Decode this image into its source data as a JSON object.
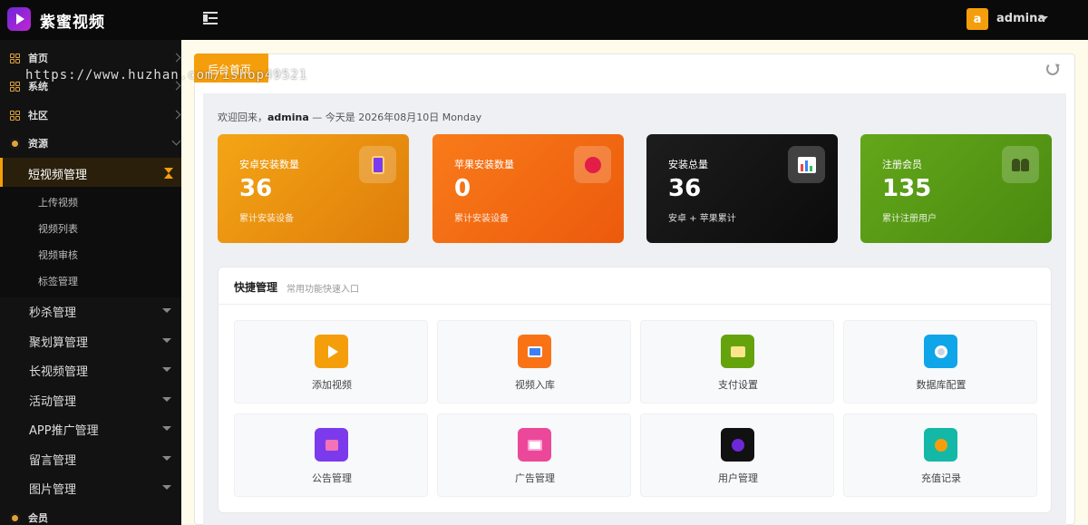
{
  "app": {
    "title": "紫蜜视频"
  },
  "header": {
    "user_initial": "a",
    "user_name": "admina"
  },
  "watermark": "https://www.huzhan.com/ishop49521",
  "sidebar": {
    "top_items": [
      "首页",
      "系统",
      "社区",
      "资源"
    ],
    "active": "短视频管理",
    "sub_items": [
      "上传视频",
      "视频列表",
      "视频审核",
      "标签管理"
    ],
    "groups": [
      "秒杀管理",
      "聚划算管理",
      "长视频管理",
      "活动管理",
      "APP推广管理",
      "留言管理",
      "图片管理"
    ],
    "bottom_item": "会员"
  },
  "tab": {
    "label": "后台首页"
  },
  "welcome": {
    "prefix": "欢迎回来，",
    "user": "admina",
    "suffix": " — 今天是 2026年08月10日 Monday"
  },
  "stats": [
    {
      "label": "安卓安装数量",
      "value": "36",
      "sub": "累计安装设备",
      "icon": "calculator-icon"
    },
    {
      "label": "苹果安装数量",
      "value": "0",
      "sub": "累计安装设备",
      "icon": "apple-icon"
    },
    {
      "label": "安装总量",
      "value": "36",
      "sub": "安卓 + 苹果累计",
      "icon": "bar-chart-icon"
    },
    {
      "label": "注册会员",
      "value": "135",
      "sub": "累计注册用户",
      "icon": "users-icon"
    }
  ],
  "quick": {
    "title": "快捷管理",
    "subtitle": "常用功能快速入口",
    "items": [
      {
        "label": "添加视频",
        "icon": "play-icon",
        "color": "#f59e0b"
      },
      {
        "label": "视频入库",
        "icon": "inbox-icon",
        "color": "#f97316"
      },
      {
        "label": "支付设置",
        "icon": "credit-card-icon",
        "color": "#65a30d"
      },
      {
        "label": "数据库配置",
        "icon": "gear-icon",
        "color": "#0ea5e9"
      },
      {
        "label": "公告管理",
        "icon": "megaphone-icon",
        "color": "#7c3aed"
      },
      {
        "label": "广告管理",
        "icon": "newspaper-icon",
        "color": "#ec4899"
      },
      {
        "label": "用户管理",
        "icon": "user-icon",
        "color": "#111111"
      },
      {
        "label": "充值记录",
        "icon": "money-bag-icon",
        "color": "#14b8a6"
      }
    ]
  }
}
